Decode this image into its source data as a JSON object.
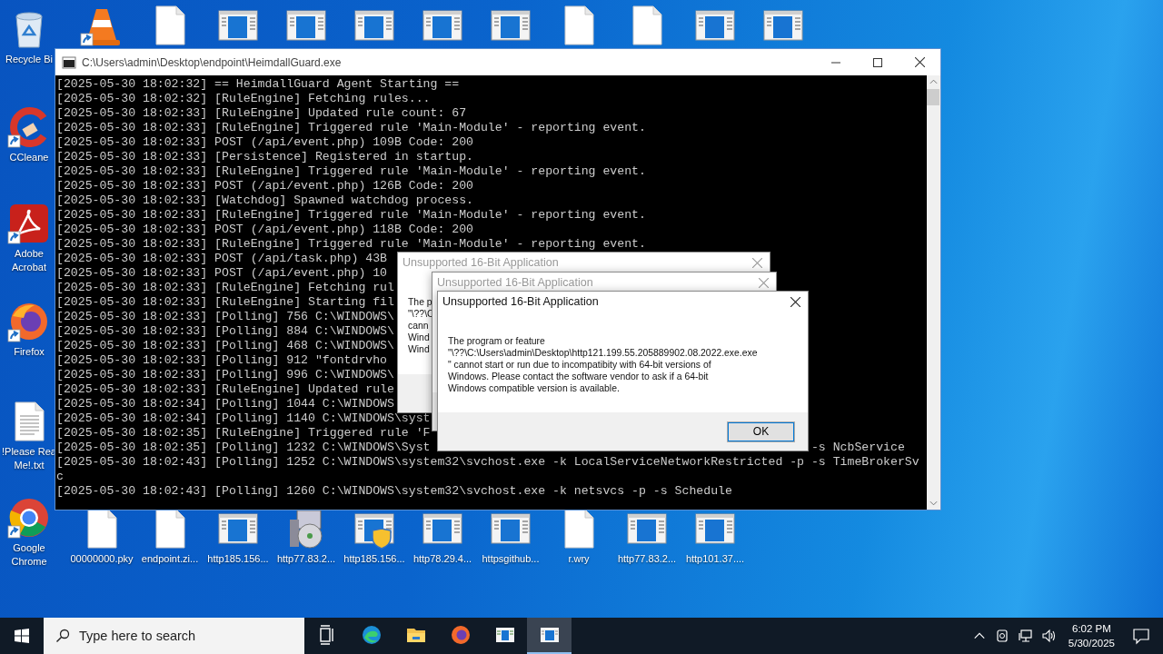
{
  "desktop": {
    "left_column": [
      {
        "kind": "recycle-bin",
        "shortcut": false,
        "label": "Recycle Bi"
      },
      {
        "kind": "cleaner",
        "shortcut": true,
        "label": "CCleane"
      },
      {
        "kind": "pdf",
        "shortcut": true,
        "label": "Adobe Acrobat"
      },
      {
        "kind": "firefox",
        "shortcut": true,
        "label": "Firefox"
      },
      {
        "kind": "text-file",
        "shortcut": false,
        "label": "!Please Rea\nMe!.txt"
      },
      {
        "kind": "chrome",
        "shortcut": true,
        "label": "Google Chrome"
      }
    ],
    "top_row": [
      {
        "kind": "cone",
        "shortcut": true
      },
      {
        "kind": "blank-file",
        "shortcut": false
      },
      {
        "kind": "app-window",
        "shortcut": false
      },
      {
        "kind": "app-window",
        "shortcut": false
      },
      {
        "kind": "app-window",
        "shortcut": false
      },
      {
        "kind": "app-window",
        "shortcut": false
      },
      {
        "kind": "app-window",
        "shortcut": false
      },
      {
        "kind": "blank-file",
        "shortcut": false
      },
      {
        "kind": "blank-file",
        "shortcut": false
      },
      {
        "kind": "app-window",
        "shortcut": false
      },
      {
        "kind": "app-window",
        "shortcut": false
      }
    ],
    "bottom_row": [
      {
        "kind": "blank-file",
        "shortcut": false,
        "label": "00000000.pky"
      },
      {
        "kind": "blank-file",
        "shortcut": false,
        "label": "endpoint.zi..."
      },
      {
        "kind": "app-window",
        "shortcut": false,
        "label": "http185.156..."
      },
      {
        "kind": "installer",
        "shortcut": false,
        "label": "http77.83.2..."
      },
      {
        "kind": "shield-window",
        "shortcut": false,
        "label": "http185.156..."
      },
      {
        "kind": "app-window",
        "shortcut": false,
        "label": "http78.29.4..."
      },
      {
        "kind": "app-window",
        "shortcut": false,
        "label": "httpsgithub..."
      },
      {
        "kind": "blank-file",
        "shortcut": false,
        "label": "r.wry"
      },
      {
        "kind": "app-window",
        "shortcut": false,
        "label": "http77.83.2..."
      },
      {
        "kind": "app-window",
        "shortcut": false,
        "label": "http101.37...."
      }
    ]
  },
  "console": {
    "title": "C:\\Users\\admin\\Desktop\\endpoint\\HeimdallGuard.exe",
    "lines": [
      {
        "text": "[2025-05-30 18:02:32] == HeimdallGuard Agent Starting =="
      },
      {
        "text": "[2025-05-30 18:02:32] [RuleEngine] Fetching rules..."
      },
      {
        "text": "[2025-05-30 18:02:33] [RuleEngine] Updated rule count: 67"
      },
      {
        "text": "[2025-05-30 18:02:33] [RuleEngine] Triggered rule 'Main-Module' - reporting event."
      },
      {
        "text": "[2025-05-30 18:02:33] POST (/api/event.php) 109B Code: 200"
      },
      {
        "text": "[2025-05-30 18:02:33] [Persistence] Registered in startup."
      },
      {
        "text": "[2025-05-30 18:02:33] [RuleEngine] Triggered rule 'Main-Module' - reporting event."
      },
      {
        "text": "[2025-05-30 18:02:33] POST (/api/event.php) 126B Code: 200"
      },
      {
        "text": "[2025-05-30 18:02:33] [Watchdog] Spawned watchdog process."
      },
      {
        "text": "[2025-05-30 18:02:33] [RuleEngine] Triggered rule 'Main-Module' - reporting event."
      },
      {
        "text": "[2025-05-30 18:02:33] POST (/api/event.php) 118B Code: 200"
      },
      {
        "text": "[2025-05-30 18:02:33] [RuleEngine] Triggered rule 'Main-Module' - reporting event."
      },
      {
        "text": "[2025-05-30 18:02:33] POST (/api/task.php) 43B"
      },
      {
        "text": "[2025-05-30 18:02:33] POST (/api/event.php) 10"
      },
      {
        "text": "[2025-05-30 18:02:33] [RuleEngine] Fetching rul"
      },
      {
        "text": "[2025-05-30 18:02:33] [RuleEngine] Starting fil"
      },
      {
        "text": "[2025-05-30 18:02:33] [Polling] 756 C:\\WINDOWS\\"
      },
      {
        "text": "[2025-05-30 18:02:33] [Polling] 884 C:\\WINDOWS\\"
      },
      {
        "text": "[2025-05-30 18:02:33] [Polling] 468 C:\\WINDOWS\\"
      },
      {
        "text": "[2025-05-30 18:02:33] [Polling] 912 \"fontdrvho"
      },
      {
        "text": "[2025-05-30 18:02:33] [Polling] 996 C:\\WINDOWS\\"
      },
      {
        "text": "[2025-05-30 18:02:33] [RuleEngine] Updated rule"
      },
      {
        "text": "[2025-05-30 18:02:34] [Polling] 1044 C:\\WINDOWS"
      },
      {
        "text": "[2025-05-30 18:02:34] [Polling] 1140 C:\\WINDOWS\\syst"
      },
      {
        "text": "[2025-05-30 18:02:35] [RuleEngine] Triggered rule 'F"
      },
      {
        "text": "[2025-05-30 18:02:35] [Polling] 1232 C:\\WINDOWS\\Syst",
        "tail": "-s NcbService"
      },
      {
        "text": "[2025-05-30 18:02:43] [Polling] 1252 C:\\WINDOWS\\system32\\svchost.exe -k LocalServiceNetworkRestricted -p -s TimeBrokerSv"
      },
      {
        "text": "c"
      },
      {
        "text": "[2025-05-30 18:02:43] [Polling] 1260 C:\\WINDOWS\\system32\\svchost.exe -k netsvcs -p -s Schedule"
      }
    ]
  },
  "dialogs": [
    {
      "title": "Unsupported 16-Bit Application",
      "active": false,
      "message": "The p\n\"\\??\\C\ncann\nWind\nWind"
    },
    {
      "title": "Unsupported 16-Bit Application",
      "active": false
    },
    {
      "title": "Unsupported 16-Bit Application",
      "active": true,
      "message": "The program or feature\n\"\\??\\C:\\Users\\admin\\Desktop\\http121.199.55.205889902.08.2022.exe.exe\n\" cannot start or run due to incompatibity with 64-bit versions of\nWindows. Please contact the software vendor to ask if a 64-bit\nWindows compatible version is available.",
      "button": "OK"
    }
  ],
  "taskbar": {
    "search": {
      "placeholder": "Type here to search"
    },
    "apps": [
      {
        "kind": "task-view",
        "selected": false
      },
      {
        "kind": "edge",
        "selected": false
      },
      {
        "kind": "explorer",
        "selected": false
      },
      {
        "kind": "firefox",
        "selected": false
      },
      {
        "kind": "app-window",
        "selected": false
      },
      {
        "kind": "console",
        "selected": true
      }
    ],
    "time": "6:02 PM",
    "date": "5/30/2025"
  }
}
